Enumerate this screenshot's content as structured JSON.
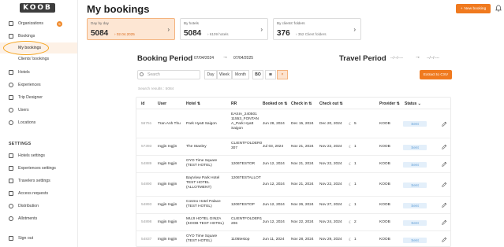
{
  "app": {
    "logo_text": "KOOB"
  },
  "sidebar": {
    "items": [
      {
        "label": "Organizations",
        "badge": "5"
      },
      {
        "label": "Bookings"
      },
      {
        "label": "My bookings",
        "active": true
      },
      {
        "label": "Clients' bookings"
      },
      {
        "label": "Hotels"
      },
      {
        "label": "Experiences"
      },
      {
        "label": "Trip Designer"
      },
      {
        "label": "Users"
      },
      {
        "label": "Locations"
      }
    ],
    "settings_title": "SETTINGS",
    "settings_items": [
      {
        "label": "Hotels settings"
      },
      {
        "label": "Experiences settings"
      },
      {
        "label": "Travelers settings"
      },
      {
        "label": "Access requests"
      },
      {
        "label": "Distribution"
      },
      {
        "label": "Allotments"
      }
    ],
    "signout": "Sign out"
  },
  "header": {
    "title": "My bookings",
    "new_booking": "New booking",
    "new_booking_icon": "plus-icon",
    "bell_icon": "bell-icon"
  },
  "cards": [
    {
      "title": "Day by day",
      "value": "5084",
      "sub": "02.04.2025"
    },
    {
      "title": "By hotels",
      "value": "5084",
      "sub": "6109 hotels"
    },
    {
      "title": "By clients' folders",
      "value": "376",
      "sub": "352 Client folders"
    }
  ],
  "booking_period": {
    "title": "Booking Period",
    "from": "07/04/2024",
    "to": "07/04/2025"
  },
  "travel_period": {
    "title": "Travel Period",
    "from": "--/--/----",
    "to": "--/--/----"
  },
  "filters": {
    "search_placeholder": "Search",
    "segments": [
      "Day",
      "Week",
      "Month"
    ],
    "bo_label": "BO",
    "x_label": "×",
    "export": "Extract to CSV"
  },
  "search_results": "Search results : 5084",
  "table": {
    "headers": [
      "id",
      "User",
      "Hotel",
      "RR",
      "Booked on",
      "Check in",
      "Check out",
      "Provider",
      "Status"
    ],
    "rows": [
      {
        "id": "56751",
        "user": "Tran Anh Thu",
        "hotel": "Park Hyatt Saigon",
        "rr": "EASIA_240501 11553_FONTAN A_Park Hyatt Saigon",
        "booked": "Jun 28, 2024",
        "checkin": "Dec 15, 2024",
        "checkout": "Dec 20, 2024",
        "nights": "5",
        "provider": "KOOB",
        "status": "Sent"
      },
      {
        "id": "57393",
        "user": "Ingjin Ingjin",
        "hotel": "The Stanley",
        "rr": "CLIENTFOLDER0 307",
        "booked": "Jul 03, 2024",
        "checkin": "Nov 21, 2024",
        "checkout": "Nov 22, 2024",
        "nights": "1",
        "provider": "KOOB",
        "status": "Sent"
      },
      {
        "id": "54889",
        "user": "Ingjin Ingjin",
        "hotel": "OYO Time Square (TEST HOTEL)",
        "rr": "1206TESTOR",
        "booked": "Jun 12, 2024",
        "checkin": "Nov 21, 2024",
        "checkout": "Nov 22, 2024",
        "nights": "1",
        "provider": "KOOB",
        "status": "Sent"
      },
      {
        "id": "54890",
        "user": "Ingjin Ingjin",
        "hotel": "BayView Park Hotel TEST HOTEL (ALLOTMENT)",
        "rr": "1206TESTALLOT",
        "booked": "Jun 12, 2024",
        "checkin": "Nov 21, 2024",
        "checkout": "Nov 22, 2024",
        "nights": "1",
        "provider": "KOOB",
        "status": "Sent"
      },
      {
        "id": "54893",
        "user": "Ingjin Ingjin",
        "hotel": "Cosmo Hotel Palace (TEST HOTEL)",
        "rr": "1206TESTOP",
        "booked": "Jun 12, 2024",
        "checkin": "Nov 26, 2024",
        "checkout": "Nov 27, 2024",
        "nights": "1",
        "provider": "KOOB",
        "status": "Sent"
      },
      {
        "id": "54898",
        "user": "Ingjin Ingjin",
        "hotel": "MUJI HOTEL GINZA (KOOB TEST HOTEL)",
        "rr": "CLIENTFOLDER1 206",
        "booked": "Jun 12, 2024",
        "checkin": "Nov 22, 2024",
        "checkout": "Nov 24, 2024",
        "nights": "2",
        "provider": "KOOB",
        "status": "Sent"
      },
      {
        "id": "54837",
        "user": "Ingjin Ingjin",
        "hotel": "OYO Time Square (TEST HOTEL)",
        "rr": "1106testop",
        "booked": "Jun 11, 2024",
        "checkin": "Nov 28, 2024",
        "checkout": "Nov 29, 2024",
        "nights": "1",
        "provider": "KOOB",
        "status": "Sent"
      }
    ]
  },
  "colors": {
    "accent": "#f07a1f",
    "status_bg": "#e3effa",
    "status_text": "#5b9bd5",
    "active_card": "#fde6d3"
  }
}
